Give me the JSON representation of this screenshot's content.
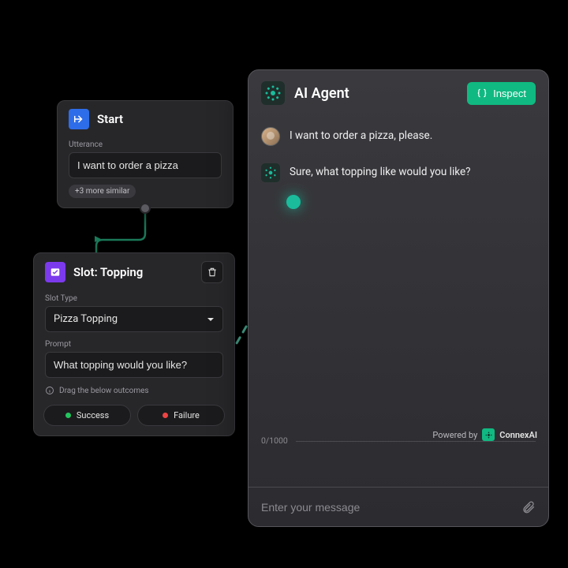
{
  "start": {
    "title": "Start",
    "utterance_label": "Utterance",
    "utterance_value": "I want to order a pizza",
    "similar_pill": "+3 more similar"
  },
  "slot": {
    "title": "Slot: Topping",
    "slot_type_label": "Slot Type",
    "slot_type_value": "Pizza Topping",
    "prompt_label": "Prompt",
    "prompt_value": "What topping would you like?",
    "drag_hint": "Drag the below outcomes",
    "success_label": "Success",
    "failure_label": "Failure"
  },
  "agent": {
    "title": "AI Agent",
    "inspect_label": "Inspect",
    "messages": {
      "user": "I want to order a pizza, please.",
      "bot": "Sure, what topping like would you like?"
    },
    "powered_prefix": "Powered by",
    "brand": "ConnexAI",
    "counter": "0/1000",
    "composer_placeholder": "Enter your message"
  }
}
